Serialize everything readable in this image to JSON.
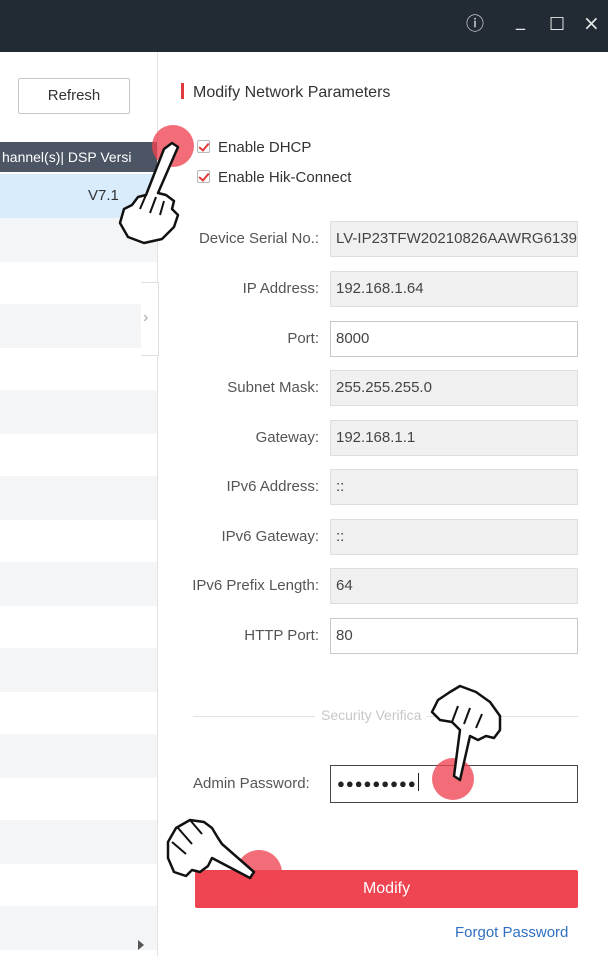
{
  "window": {
    "controls": [
      {
        "name": "info-icon",
        "glyph": "ⓘ"
      },
      {
        "name": "minimize-icon",
        "glyph": "_"
      },
      {
        "name": "maximize-icon",
        "glyph": "☐"
      },
      {
        "name": "close-icon",
        "glyph": "×"
      }
    ]
  },
  "left_panel": {
    "refresh_label": "Refresh",
    "table_header": "hannel(s)| DSP Versi",
    "selected_row_value": "V7.1",
    "collapse_glyph": "›"
  },
  "form": {
    "title": "Modify Network Parameters",
    "enable_dhcp": {
      "label": "Enable DHCP",
      "checked": true
    },
    "enable_hik_connect": {
      "label": "Enable Hik-Connect",
      "checked": true
    },
    "fields": [
      {
        "label": "Device Serial No.:",
        "value": "LV-IP23TFW20210826AAWRG6139",
        "editable": false
      },
      {
        "label": "IP Address:",
        "value": "192.168.1.64",
        "editable": false
      },
      {
        "label": "Port:",
        "value": "8000",
        "editable": true
      },
      {
        "label": "Subnet Mask:",
        "value": "255.255.255.0",
        "editable": false
      },
      {
        "label": "Gateway:",
        "value": "192.168.1.1",
        "editable": false
      },
      {
        "label": "IPv6 Address:",
        "value": "::",
        "editable": false
      },
      {
        "label": "IPv6 Gateway:",
        "value": "::",
        "editable": false
      },
      {
        "label": "IPv6 Prefix Length:",
        "value": "64",
        "editable": false
      },
      {
        "label": "HTTP Port:",
        "value": "80",
        "editable": true
      }
    ],
    "security_divider": "Security Verifica",
    "admin_password_label": "Admin Password:",
    "admin_password_value": "●●●●●●●●●",
    "modify_label": "Modify",
    "forgot_password_label": "Forgot Password"
  },
  "colors": {
    "accent": "#ef4452",
    "link": "#2f6fc2",
    "titlebar": "#222a33",
    "selected_row": "#d9ecfb"
  }
}
